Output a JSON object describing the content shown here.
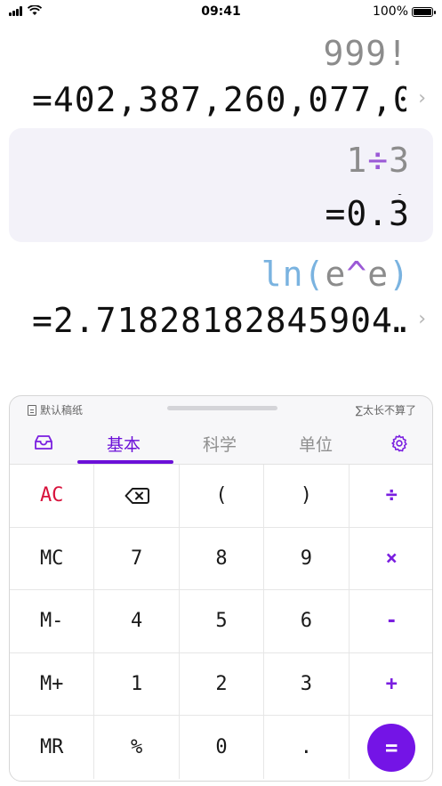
{
  "status_bar": {
    "time": "09:41",
    "battery": "100%"
  },
  "history": [
    {
      "expression": "999!",
      "result": "=402,387,260,077,0"
    },
    {
      "expression_left": "1",
      "expression_op": "÷",
      "expression_right": "3",
      "result_prefix": "=0.",
      "result_repeating": "3"
    },
    {
      "expression_fn": "ln(",
      "expression_a": "e",
      "expression_op": "^",
      "expression_b": "e",
      "expression_close": ")",
      "result": "=2.71828182845904…"
    }
  ],
  "panel": {
    "draft_label": "默认稿纸",
    "too_long_label": "∑太长不算了",
    "tabs": [
      "基本",
      "科学",
      "单位"
    ],
    "active_tab": "基本",
    "tray_icon": "tray-icon",
    "settings_icon": "gear-icon"
  },
  "keys": [
    [
      "AC",
      "⌫",
      "(",
      ")",
      "÷"
    ],
    [
      "MC",
      "7",
      "8",
      "9",
      "×"
    ],
    [
      "M-",
      "4",
      "5",
      "6",
      "-"
    ],
    [
      "M+",
      "1",
      "2",
      "3",
      "+"
    ],
    [
      "MR",
      "%",
      "0",
      ".",
      "="
    ]
  ],
  "colors": {
    "accent": "#7414E6",
    "ac_red": "#D8123C",
    "operator_purple": "#9B59D6",
    "function_blue": "#7AB3E0"
  }
}
